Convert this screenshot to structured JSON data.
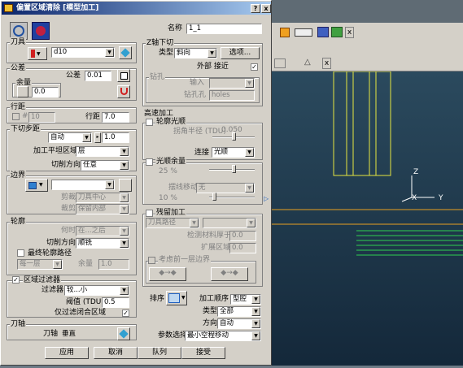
{
  "window": {
    "title": "偏置区域清除 [模型加工]",
    "help_button": "?",
    "close_button": "x"
  },
  "background": {
    "toolbar_close": "x",
    "toolbar_close2": "x",
    "axis": {
      "z": "Z",
      "x": "X",
      "y": "Y"
    }
  },
  "name": {
    "label": "名称",
    "value": "1_1"
  },
  "tool": {
    "label": "刀具",
    "value": "d10"
  },
  "tolerance": {
    "section": "公差",
    "label": "公差",
    "value": "0.01",
    "allowance_label": "余量",
    "allowance_value": "0.0"
  },
  "stepover": {
    "section": "行距",
    "enabled": false,
    "check_label": "#",
    "check_value": "10",
    "label": "行距",
    "value": "7.0"
  },
  "stepdown": {
    "section": "下切步距",
    "mode": "自动",
    "value": "1.0",
    "flat_label": "加工平坦区域",
    "flat_value": "层",
    "direction_label": "切削方向",
    "direction_value": "任意"
  },
  "boundary": {
    "section": "边界",
    "value": "",
    "outer_label": "剪裁",
    "outer_value": "刀具中心",
    "inner_label": "裁剪",
    "inner_value": "保留内部"
  },
  "profile": {
    "section": "轮廓",
    "when_label": "何时",
    "when_value": "在...之后",
    "direction_label": "切削方向",
    "direction_value": "顺铣",
    "final_pass_label": "最终轮廓路径",
    "final_pass_enabled": false,
    "final_pass_mode": "每一层",
    "allowance_label": "余量",
    "allowance_value": "1.0"
  },
  "area_filter": {
    "section": "区域过滤器",
    "enabled": true,
    "filter_label": "过滤器",
    "filter_value": "较...小",
    "threshold_label": "阈值 (TDU)",
    "threshold_value": "0.5",
    "closed_only_label": "仅过滤闭合区域",
    "closed_only": true
  },
  "tool_axis": {
    "section": "刀轴",
    "label": "刀轴",
    "value": "垂直"
  },
  "plunge": {
    "section": "Z轴下切",
    "type_label": "类型",
    "type_value": "斜向",
    "options_button": "选项...",
    "approach_label": "外部 接近",
    "approach_checked": true,
    "drill_section": "钻孔",
    "input_label": "输入",
    "input_value": "",
    "drill_value_label": "钻孔孔",
    "drill_value": "holes"
  },
  "high_speed": {
    "section": "高速加工",
    "profile_smooth_label": "轮廓光顺",
    "profile_smooth": false,
    "radius_label": "拐角半径 (TDU)",
    "radius_value": "0.050",
    "connect_label": "连接",
    "connect_value": "光顺",
    "smooth_allowance_label": "光顺余量",
    "smooth_allowance": false,
    "smooth_pct": "25 %",
    "move_label": "摆线移动",
    "move_value": "无",
    "move_pct": "10 %"
  },
  "rest": {
    "section": "残留加工",
    "enabled": false,
    "mode_value": "刀具路径",
    "mode2_value": "",
    "thickness_label": "检测材料厚于",
    "thickness_value": "0.0",
    "extend_label": "扩展区域",
    "extend_value": "0.0",
    "prev_label": "考虑前一层边界"
  },
  "ordering": {
    "label": "排序",
    "order_label": "加工顺序",
    "order_value": "型腔",
    "type_label": "类型",
    "type_value": "全部",
    "direction_label": "方向",
    "direction_value": "自动",
    "param_label": "参数选择",
    "param_value": "最小空程移动"
  },
  "footer": {
    "apply": "应用",
    "cancel": "取消",
    "queue": "队列",
    "accept": "接受"
  },
  "colors": {
    "titlebar": "#0a246a",
    "viewport": "#1f3a4e",
    "toolpath_yellow": "#e6e640",
    "toolpath_green": "#30d050",
    "accent_red": "#d02020"
  }
}
